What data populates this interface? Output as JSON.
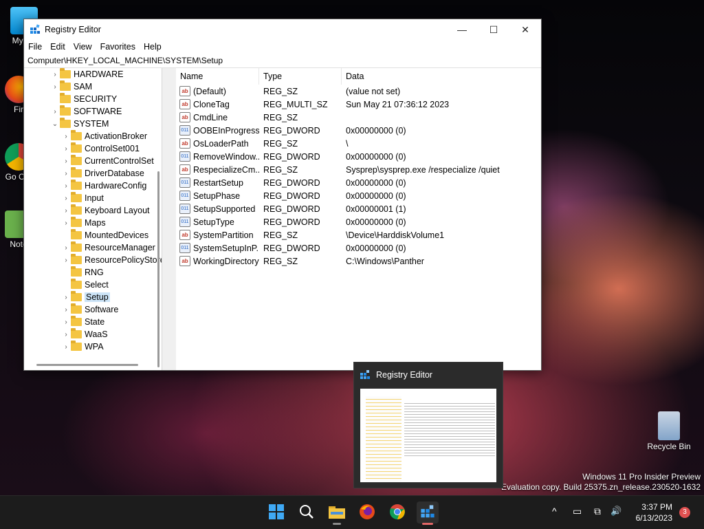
{
  "desktop": {
    "icons": [
      {
        "label": "My Co"
      },
      {
        "label": "Fir"
      },
      {
        "label": "Go Chr"
      },
      {
        "label": "Note"
      }
    ],
    "recycle_bin": {
      "label": "Recycle Bin"
    },
    "watermark": {
      "line1": "Windows 11 Pro Insider Preview",
      "line2": "Evaluation copy. Build 25375.zn_release.230520-1632"
    }
  },
  "window": {
    "title": "Registry Editor",
    "controls": {
      "minimize": "—",
      "maximize": "☐",
      "close": "✕"
    },
    "menu": [
      "File",
      "Edit",
      "View",
      "Favorites",
      "Help"
    ],
    "address": "Computer\\HKEY_LOCAL_MACHINE\\SYSTEM\\Setup",
    "tree": [
      {
        "label": "HARDWARE",
        "expander": "›",
        "level": 1
      },
      {
        "label": "SAM",
        "expander": "›",
        "level": 1
      },
      {
        "label": "SECURITY",
        "expander": "",
        "level": 1
      },
      {
        "label": "SOFTWARE",
        "expander": "›",
        "level": 1
      },
      {
        "label": "SYSTEM",
        "expander": "⌄",
        "level": 1
      },
      {
        "label": "ActivationBroker",
        "expander": "›",
        "level": 2
      },
      {
        "label": "ControlSet001",
        "expander": "›",
        "level": 2
      },
      {
        "label": "CurrentControlSet",
        "expander": "›",
        "level": 2
      },
      {
        "label": "DriverDatabase",
        "expander": "›",
        "level": 2
      },
      {
        "label": "HardwareConfig",
        "expander": "›",
        "level": 2
      },
      {
        "label": "Input",
        "expander": "›",
        "level": 2
      },
      {
        "label": "Keyboard Layout",
        "expander": "›",
        "level": 2
      },
      {
        "label": "Maps",
        "expander": "›",
        "level": 2
      },
      {
        "label": "MountedDevices",
        "expander": "",
        "level": 2
      },
      {
        "label": "ResourceManager",
        "expander": "›",
        "level": 2
      },
      {
        "label": "ResourcePolicyStore",
        "expander": "›",
        "level": 2
      },
      {
        "label": "RNG",
        "expander": "",
        "level": 2
      },
      {
        "label": "Select",
        "expander": "",
        "level": 2
      },
      {
        "label": "Setup",
        "expander": "›",
        "level": 2,
        "selected": true
      },
      {
        "label": "Software",
        "expander": "›",
        "level": 2
      },
      {
        "label": "State",
        "expander": "›",
        "level": 2
      },
      {
        "label": "WaaS",
        "expander": "›",
        "level": 2
      },
      {
        "label": "WPA",
        "expander": "›",
        "level": 2
      }
    ],
    "columns": {
      "name": "Name",
      "type": "Type",
      "data": "Data"
    },
    "values": [
      {
        "icon": "sz",
        "name": "(Default)",
        "type": "REG_SZ",
        "data": "(value not set)"
      },
      {
        "icon": "sz",
        "name": "CloneTag",
        "type": "REG_MULTI_SZ",
        "data": "Sun May 21 07:36:12 2023"
      },
      {
        "icon": "sz",
        "name": "CmdLine",
        "type": "REG_SZ",
        "data": ""
      },
      {
        "icon": "dw",
        "name": "OOBEInProgress",
        "type": "REG_DWORD",
        "data": "0x00000000 (0)"
      },
      {
        "icon": "sz",
        "name": "OsLoaderPath",
        "type": "REG_SZ",
        "data": "\\"
      },
      {
        "icon": "dw",
        "name": "RemoveWindow...",
        "type": "REG_DWORD",
        "data": "0x00000000 (0)"
      },
      {
        "icon": "sz",
        "name": "RespecializeCm...",
        "type": "REG_SZ",
        "data": "Sysprep\\sysprep.exe /respecialize /quiet"
      },
      {
        "icon": "dw",
        "name": "RestartSetup",
        "type": "REG_DWORD",
        "data": "0x00000000 (0)"
      },
      {
        "icon": "dw",
        "name": "SetupPhase",
        "type": "REG_DWORD",
        "data": "0x00000000 (0)"
      },
      {
        "icon": "dw",
        "name": "SetupSupported",
        "type": "REG_DWORD",
        "data": "0x00000001 (1)"
      },
      {
        "icon": "dw",
        "name": "SetupType",
        "type": "REG_DWORD",
        "data": "0x00000000 (0)"
      },
      {
        "icon": "sz",
        "name": "SystemPartition",
        "type": "REG_SZ",
        "data": "\\Device\\HarddiskVolume1"
      },
      {
        "icon": "dw",
        "name": "SystemSetupInP...",
        "type": "REG_DWORD",
        "data": "0x00000000 (0)"
      },
      {
        "icon": "sz",
        "name": "WorkingDirectory",
        "type": "REG_SZ",
        "data": "C:\\Windows\\Panther"
      }
    ]
  },
  "thumbnail": {
    "title": "Registry Editor"
  },
  "taskbar": {
    "apps": [
      {
        "name": "start-button-icon"
      },
      {
        "name": "search-icon"
      },
      {
        "name": "file-explorer-icon"
      },
      {
        "name": "firefox-icon"
      },
      {
        "name": "chrome-icon"
      },
      {
        "name": "registry-editor-icon",
        "active": true
      }
    ],
    "time": "3:37 PM",
    "date": "6/13/2023",
    "notification_count": "3",
    "tray": {
      "chevron": "^",
      "network": "▭",
      "display": "⧉",
      "volume": "🔊"
    }
  },
  "colors": {
    "selection": "#cce4f7",
    "taskbar": "#1c1c1c",
    "badge": "#e05050"
  }
}
